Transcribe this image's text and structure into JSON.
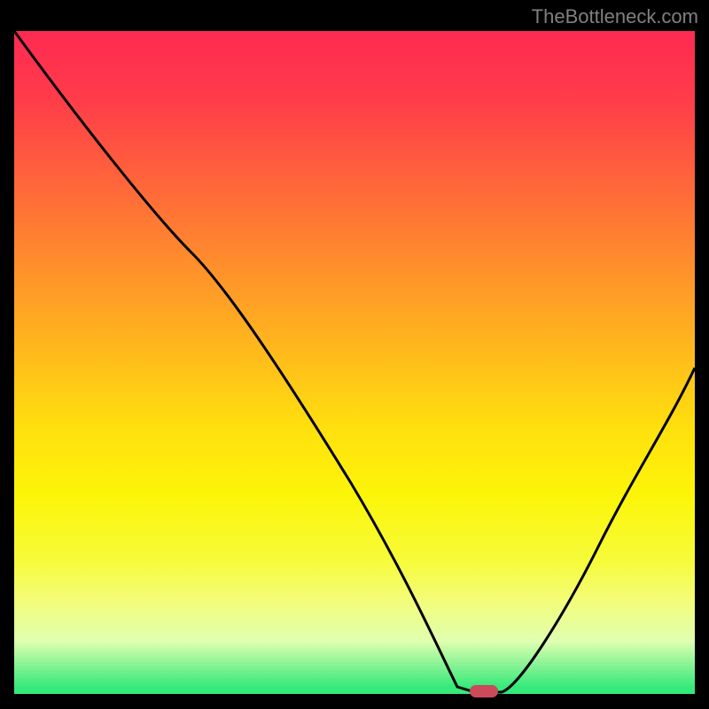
{
  "watermark": "TheBottleneck.com",
  "chart_data": {
    "type": "line",
    "title": "",
    "xlabel": "",
    "ylabel": "",
    "x": [
      0,
      5,
      10,
      15,
      20,
      25,
      30,
      35,
      40,
      45,
      50,
      55,
      60,
      65,
      68,
      70,
      75,
      80,
      85,
      90,
      95,
      100
    ],
    "values": [
      100,
      93,
      86,
      79,
      73,
      68,
      60,
      52,
      44,
      36,
      27,
      19,
      11,
      2,
      0,
      0,
      6,
      15,
      24,
      32,
      41,
      50
    ],
    "xlim": [
      0,
      100
    ],
    "ylim": [
      0,
      100
    ],
    "annotations": [
      {
        "name": "optimal-marker",
        "x": 69,
        "y": 0
      }
    ],
    "gradient_stops": [
      {
        "pct": 0,
        "color": "#ff2a52"
      },
      {
        "pct": 50,
        "color": "#ffbf1a"
      },
      {
        "pct": 80,
        "color": "#f6fb3a"
      },
      {
        "pct": 99,
        "color": "#35e97b"
      },
      {
        "pct": 100,
        "color": "#35e97b"
      }
    ]
  }
}
